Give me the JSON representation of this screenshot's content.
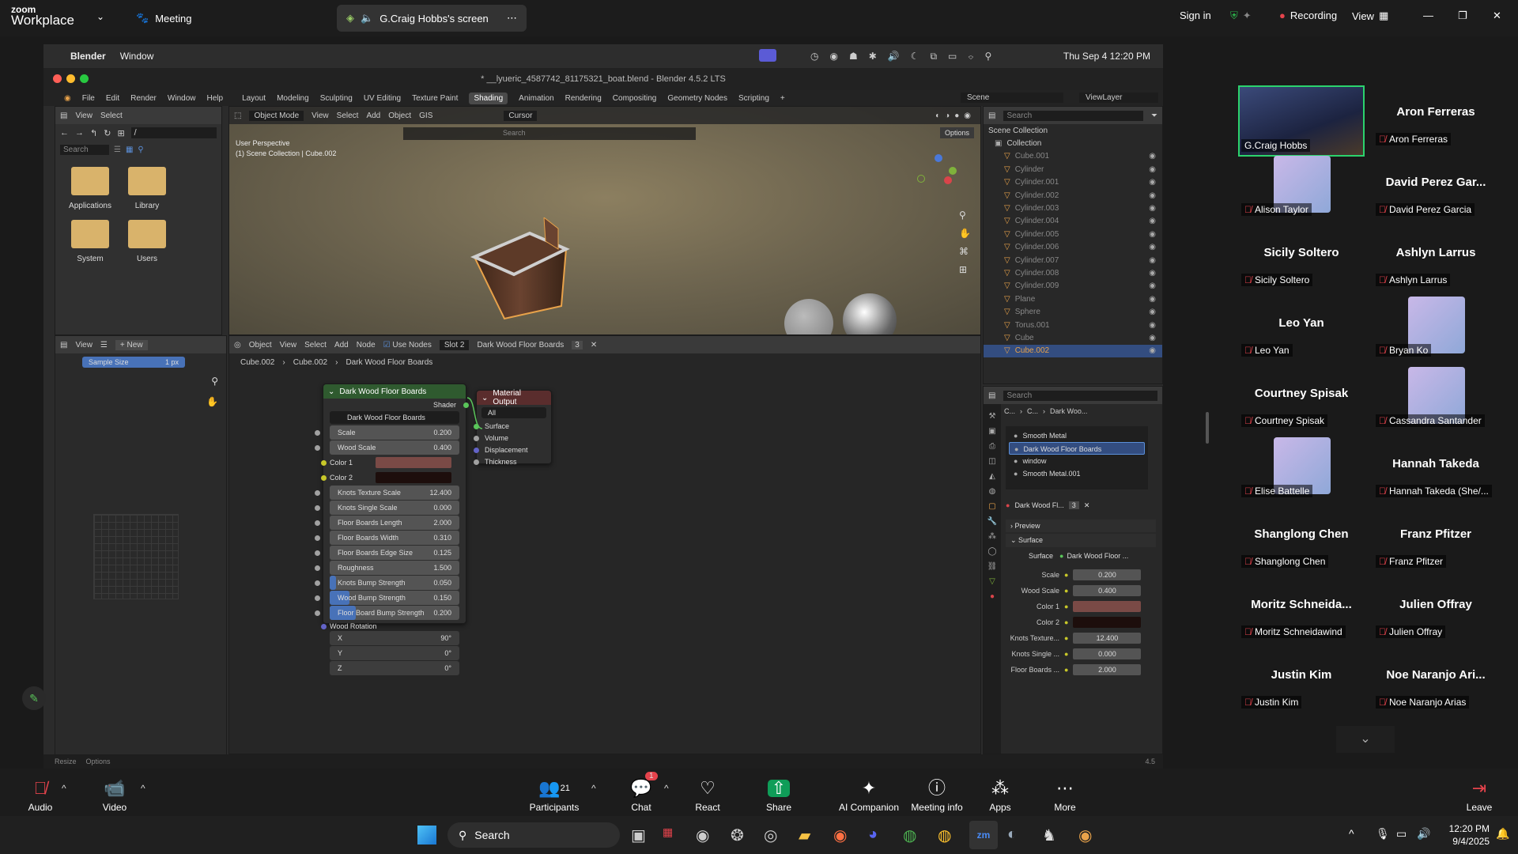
{
  "zoom_header": {
    "logo_small": "zoom",
    "logo_big": "Workplace",
    "meeting_label": "Meeting",
    "share_tab": "G.Craig Hobbs's screen",
    "sign_in": "Sign in",
    "recording": "Recording",
    "view": "View"
  },
  "mac_menubar": {
    "app": "Blender",
    "menu": "Window",
    "clock": "Thu Sep 4  12:20 PM"
  },
  "blender": {
    "title": "* __lyueric_4587742_81175321_boat.blend - Blender 4.5.2 LTS",
    "menu": [
      "File",
      "Edit",
      "Render",
      "Window",
      "Help"
    ],
    "workspaces": [
      "Layout",
      "Modeling",
      "Sculpting",
      "UV Editing",
      "Texture Paint",
      "Shading",
      "Animation",
      "Rendering",
      "Compositing",
      "Geometry Nodes",
      "Scripting"
    ],
    "active_workspace": "Shading",
    "scene": "Scene",
    "view_layer": "ViewLayer",
    "filebrowser": {
      "view": "View",
      "select": "Select",
      "path": "/",
      "search_placeholder": "Search",
      "folders": [
        "Applications",
        "Library",
        "System",
        "Users"
      ]
    },
    "viewport": {
      "mode": "Object Mode",
      "menus": [
        "View",
        "Select",
        "Add",
        "Object",
        "GIS"
      ],
      "cursor": "Cursor",
      "options": "Options",
      "line1": "User Perspective",
      "line2": "(1) Scene Collection | Cube.002",
      "search_placeholder": "Search"
    },
    "image_editor": {
      "view": "View",
      "new": "New",
      "sample_label": "Sample Size",
      "sample_value": "1 px"
    },
    "node_editor": {
      "object": "Object",
      "menus": [
        "View",
        "Select",
        "Add",
        "Node"
      ],
      "use_nodes": "Use Nodes",
      "slot": "Slot 2",
      "material": "Dark Wood Floor Boards",
      "users": "3",
      "breadcrumb": [
        "Cube.002",
        "Cube.002",
        "Dark Wood Floor Boards"
      ]
    },
    "node_group": {
      "title": "Dark Wood Floor Boards",
      "shader_out": "Shader",
      "group_name": "Dark Wood Floor Boards",
      "inputs": [
        {
          "label": "Scale",
          "value": "0.200"
        },
        {
          "label": "Wood Scale",
          "value": "0.400"
        },
        {
          "label": "Color 1",
          "value": "",
          "color": "#7a4a46"
        },
        {
          "label": "Color 2",
          "value": "",
          "color": "#1d0e0c"
        },
        {
          "label": "Knots Texture Scale",
          "value": "12.400"
        },
        {
          "label": "Knots Single Scale",
          "value": "0.000"
        },
        {
          "label": "Floor Boards Length",
          "value": "2.000"
        },
        {
          "label": "Floor Boards Width",
          "value": "0.310"
        },
        {
          "label": "Floor Boards Edge Size",
          "value": "0.125"
        },
        {
          "label": "Roughness",
          "value": "1.500"
        },
        {
          "label": "Knots Bump Strength",
          "value": "0.050",
          "fill": 0.05
        },
        {
          "label": "Wood Bump Strength",
          "value": "0.150",
          "fill": 0.15
        },
        {
          "label": "Floor Board Bump Strength",
          "value": "0.200",
          "fill": 0.2
        }
      ],
      "rotation_label": "Wood Rotation",
      "rotation": [
        {
          "axis": "X",
          "value": "90°"
        },
        {
          "axis": "Y",
          "value": "0°"
        },
        {
          "axis": "Z",
          "value": "0°"
        }
      ]
    },
    "material_output": {
      "title": "Material Output",
      "target": "All",
      "sockets": [
        "Surface",
        "Volume",
        "Displacement",
        "Thickness"
      ]
    },
    "outliner": {
      "search_placeholder": "Search",
      "scene_collection": "Scene Collection",
      "collection": "Collection",
      "items": [
        "Cube.001",
        "Cylinder",
        "Cylinder.001",
        "Cylinder.002",
        "Cylinder.003",
        "Cylinder.004",
        "Cylinder.005",
        "Cylinder.006",
        "Cylinder.007",
        "Cylinder.008",
        "Cylinder.009",
        "Plane",
        "Sphere",
        "Torus.001",
        "Cube",
        "Cube.002"
      ],
      "selected": "Cube.002"
    },
    "properties": {
      "search_placeholder": "Search",
      "breadcrumb": [
        "C...",
        "C...",
        "Dark Woo..."
      ],
      "materials": [
        "Smooth Metal",
        "Dark Wood Floor Boards",
        "window",
        "Smooth Metal.001"
      ],
      "active_material": "Dark Wood Floor Boards",
      "mat_name": "Dark Wood Fl...",
      "mat_users": "3",
      "preview": "Preview",
      "surface": "Surface",
      "surface_label": "Surface",
      "surface_value": "Dark Wood Floor ...",
      "fields": [
        {
          "label": "Scale",
          "value": "0.200"
        },
        {
          "label": "Wood Scale",
          "value": "0.400"
        },
        {
          "label": "Color 1",
          "value": "",
          "color": "#7a4a46"
        },
        {
          "label": "Color 2",
          "value": "",
          "color": "#1d0e0c"
        },
        {
          "label": "Knots Texture...",
          "value": "12.400"
        },
        {
          "label": "Knots Single ...",
          "value": "0.000"
        },
        {
          "label": "Floor Boards ...",
          "value": "2.000"
        }
      ]
    },
    "statusbar": {
      "left1": "Resize",
      "left2": "Options",
      "version": "4.5"
    }
  },
  "participants": [
    {
      "big": "",
      "label": "G.Craig Hobbs",
      "video": true,
      "muted": false
    },
    {
      "big": "Aron Ferreras",
      "label": "Aron Ferreras"
    },
    {
      "big": "",
      "label": "Alison Taylor",
      "avatar": true
    },
    {
      "big": "David Perez Gar...",
      "label": "David Perez Garcia"
    },
    {
      "big": "Sicily Soltero",
      "label": "Sicily Soltero"
    },
    {
      "big": "Ashlyn Larrus",
      "label": "Ashlyn Larrus"
    },
    {
      "big": "Leo Yan",
      "label": "Leo Yan"
    },
    {
      "big": "",
      "label": "Bryan Ko",
      "avatar": true
    },
    {
      "big": "Courtney Spisak",
      "label": "Courtney Spisak"
    },
    {
      "big": "",
      "label": "Cassandra Santander",
      "avatar": true
    },
    {
      "big": "",
      "label": "Elise Battelle",
      "avatar": true
    },
    {
      "big": "Hannah Takeda",
      "label": "Hannah Takeda (She/..."
    },
    {
      "big": "Shanglong Chen",
      "label": "Shanglong Chen"
    },
    {
      "big": "Franz Pfitzer",
      "label": "Franz Pfitzer"
    },
    {
      "big": "Moritz  Schneida...",
      "label": "Moritz Schneidawind"
    },
    {
      "big": "Julien Offray",
      "label": "Julien Offray"
    },
    {
      "big": "Justin Kim",
      "label": "Justin Kim"
    },
    {
      "big": "Noe Naranjo Ari...",
      "label": "Noe Naranjo Arias"
    }
  ],
  "toolbar": {
    "audio": "Audio",
    "video": "Video",
    "participants": "Participants",
    "participants_count": "21",
    "chat": "Chat",
    "chat_badge": "1",
    "react": "React",
    "share": "Share",
    "companion": "AI Companion",
    "info": "Meeting info",
    "apps": "Apps",
    "more": "More",
    "leave": "Leave"
  },
  "taskbar": {
    "search": "Search",
    "time": "12:20 PM",
    "date": "9/4/2025"
  },
  "colors": {
    "accent": "#0e72ed",
    "mute": "#e5434c",
    "share": "#0f9d58",
    "blender_orange": "#e8a24a"
  }
}
